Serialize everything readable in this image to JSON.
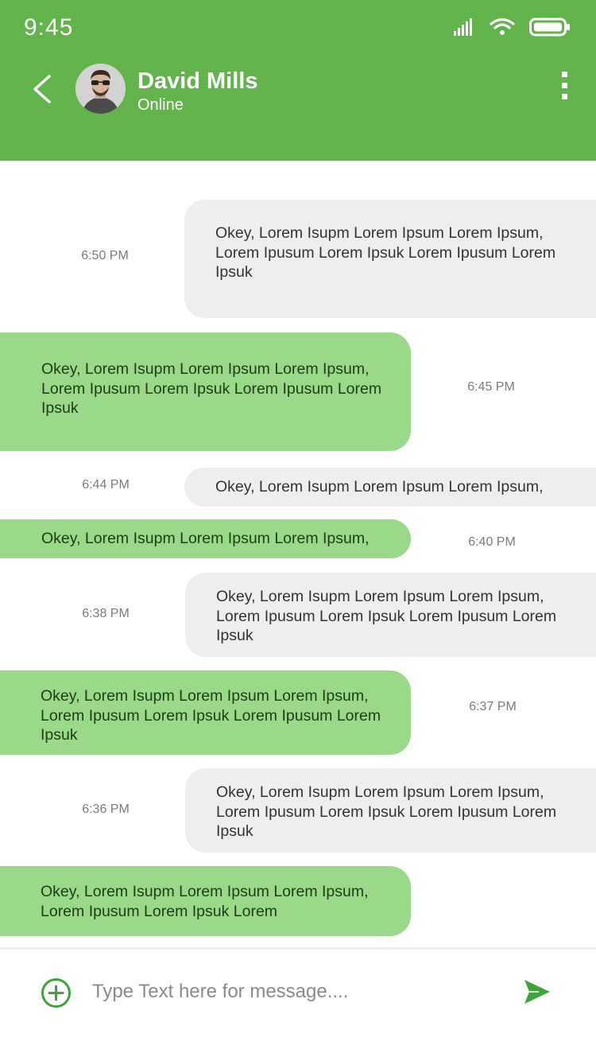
{
  "status_bar": {
    "time": "9:45"
  },
  "header": {
    "contact_name": "David Mills",
    "contact_status": "Online",
    "accent_color": "#63b34d"
  },
  "messages": [
    {
      "direction": "incoming",
      "text": "Okey, Lorem Isupm Lorem Ipsum Lorem Ipsum, Lorem Ipusum  Lorem Ipsuk Lorem Ipusum Lorem Ipsuk",
      "time": "6:50 PM"
    },
    {
      "direction": "outgoing",
      "text": "Okey, Lorem Isupm Lorem Ipsum Lorem Ipsum, Lorem Ipusum  Lorem Ipsuk Lorem Ipusum Lorem Ipsuk",
      "time": "6:45 PM"
    },
    {
      "direction": "incoming",
      "text": "Okey, Lorem Isupm Lorem Ipsum Lorem Ipsum,",
      "time": "6:44 PM"
    },
    {
      "direction": "outgoing",
      "text": "Okey, Lorem Isupm Lorem Ipsum Lorem Ipsum,",
      "time": "6:40 PM"
    },
    {
      "direction": "incoming",
      "text": "Okey, Lorem Isupm Lorem Ipsum Lorem Ipsum, Lorem Ipusum  Lorem Ipsuk Lorem Ipusum Lorem Ipsuk",
      "time": "6:38 PM"
    },
    {
      "direction": "outgoing",
      "text": "Okey, Lorem Isupm Lorem Ipsum Lorem Ipsum, Lorem Ipusum  Lorem Ipsuk Lorem Ipusum Lorem Ipsuk",
      "time": "6:37 PM"
    },
    {
      "direction": "incoming",
      "text": "Okey, Lorem Isupm Lorem Ipsum Lorem Ipsum, Lorem Ipusum  Lorem Ipsuk Lorem Ipusum Lorem Ipsuk",
      "time": "6:36 PM"
    },
    {
      "direction": "outgoing",
      "text": "Okey, Lorem Isupm Lorem Ipsum Lorem Ipsum, Lorem Ipusum  Lorem Ipsuk Lorem",
      "time": ""
    }
  ],
  "composer": {
    "placeholder": "Type Text here for message....",
    "value": ""
  },
  "icons": {
    "back": "chevron-left-icon",
    "more": "more-vertical-icon",
    "add": "add-circle-icon",
    "send": "send-icon",
    "signal": "signal-icon",
    "wifi": "wifi-icon",
    "battery": "battery-icon"
  },
  "colors": {
    "incoming_bubble": "#eeeeee",
    "outgoing_bubble": "#9bd98a",
    "brand_green": "#63b34d"
  }
}
